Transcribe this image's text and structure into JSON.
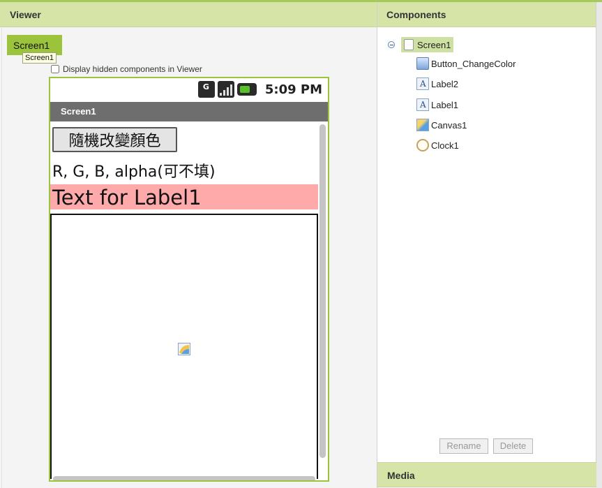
{
  "viewer": {
    "title": "Viewer",
    "screen_tab": "Screen1",
    "tooltip": "Screen1",
    "hidden_components_label": "Display hidden components in Viewer"
  },
  "phone": {
    "status_time": "5:09 PM",
    "title": "Screen1",
    "button_text": "隨機改變顏色",
    "label2_text": "R, G, B, alpha(可不填)",
    "label1_text": "Text for Label1",
    "label1_bg": "#ffaaaa"
  },
  "components": {
    "title": "Components",
    "root": "Screen1",
    "items": [
      {
        "label": "Button_ChangeColor",
        "icon": "button-icon"
      },
      {
        "label": "Label2",
        "icon": "label-icon"
      },
      {
        "label": "Label1",
        "icon": "label-icon"
      },
      {
        "label": "Canvas1",
        "icon": "canvas-icon"
      },
      {
        "label": "Clock1",
        "icon": "clock-icon"
      }
    ],
    "rename_label": "Rename",
    "delete_label": "Delete"
  },
  "media": {
    "title": "Media"
  },
  "colors": {
    "accent_green": "#9bc43c",
    "header_green": "#d6e4a8",
    "selection_green": "#cfe0a3",
    "phone_titlebar": "#6e6e6e"
  }
}
